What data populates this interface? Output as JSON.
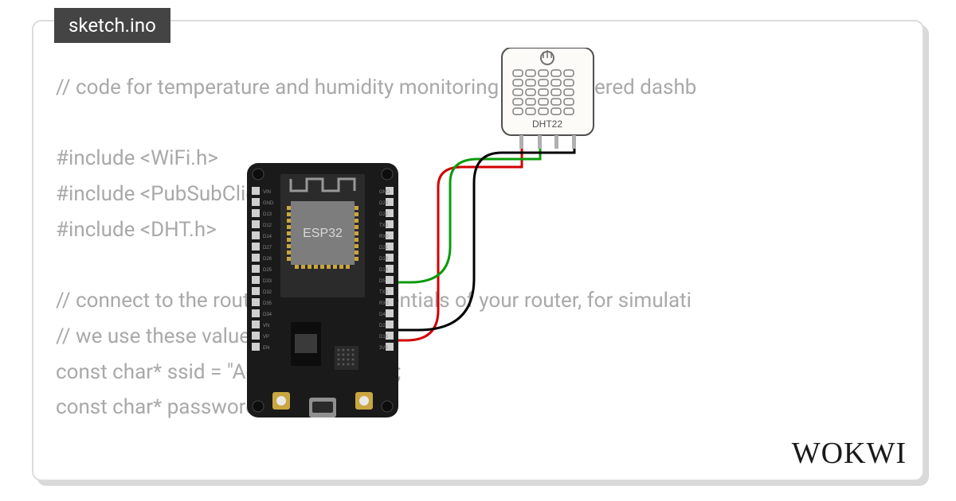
{
  "tab": {
    "filename": "sketch.ino"
  },
  "code": {
    "lines": [
      "// code for temperature and humidity monitoring using nodered dashb",
      "",
      "#include <WiFi.h>",
      "#include <PubSubClient.h>",
      "#include <DHT.h>",
      "",
      "// connect to the router, use the credentials of your router, for simulati",
      "// we use these values",
      "const char* ssid = \"Agremiabogados\";",
      "const char* password = \"63962727\";"
    ]
  },
  "board": {
    "chip_label": "ESP32"
  },
  "sensor": {
    "label": "DHT22"
  },
  "brand": {
    "logo": "WOKWI"
  }
}
